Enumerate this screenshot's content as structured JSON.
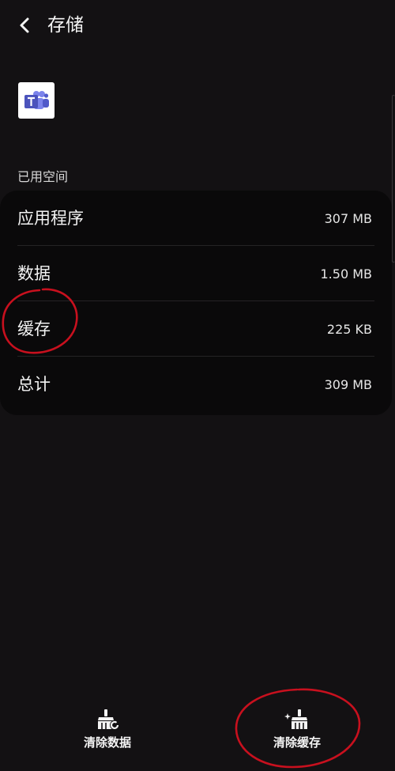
{
  "header": {
    "title": "存储"
  },
  "app": {
    "icon": "microsoft-teams-icon"
  },
  "storage": {
    "section_label": "已用空间",
    "rows": [
      {
        "label": "应用程序",
        "value": "307 MB"
      },
      {
        "label": "数据",
        "value": "1.50 MB"
      },
      {
        "label": "缓存",
        "value": "225 KB"
      },
      {
        "label": "总计",
        "value": "309 MB"
      }
    ]
  },
  "actions": {
    "clear_data": {
      "label": "清除数据",
      "icon": "broom-data-icon"
    },
    "clear_cache": {
      "label": "清除缓存",
      "icon": "broom-sparkle-icon"
    }
  },
  "colors": {
    "background": "#131113",
    "card": "#0a090a",
    "annotation_red": "#c8101e",
    "teams_purple": "#5059c9"
  }
}
